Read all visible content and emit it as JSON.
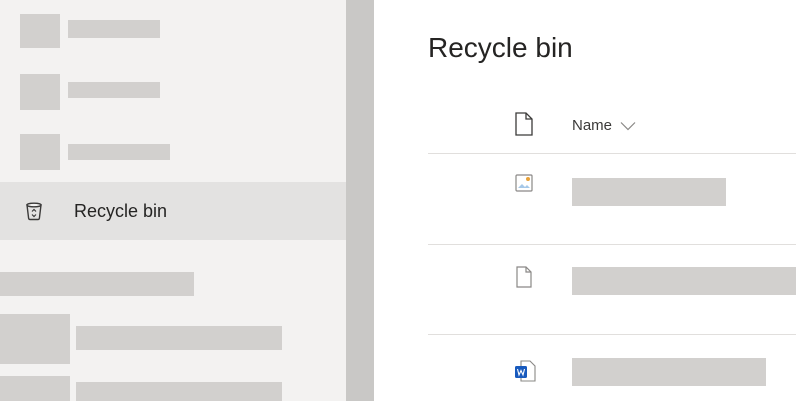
{
  "sidebar": {
    "active_item": {
      "label": "Recycle bin",
      "icon": "recycle-bin-icon"
    }
  },
  "main": {
    "title": "Recycle bin",
    "table": {
      "columns": [
        {
          "label": "Name",
          "icon": "file-type-icon",
          "sort_icon": "chevron-down-icon"
        }
      ],
      "rows": [
        {
          "icon": "image-file-icon"
        },
        {
          "icon": "generic-file-icon"
        },
        {
          "icon": "word-file-icon"
        }
      ]
    }
  },
  "colors": {
    "sidebar_bg": "#f3f2f1",
    "active_item_bg": "#e3e2e1",
    "placeholder": "#d2d0ce",
    "word_blue": "#185abd"
  }
}
